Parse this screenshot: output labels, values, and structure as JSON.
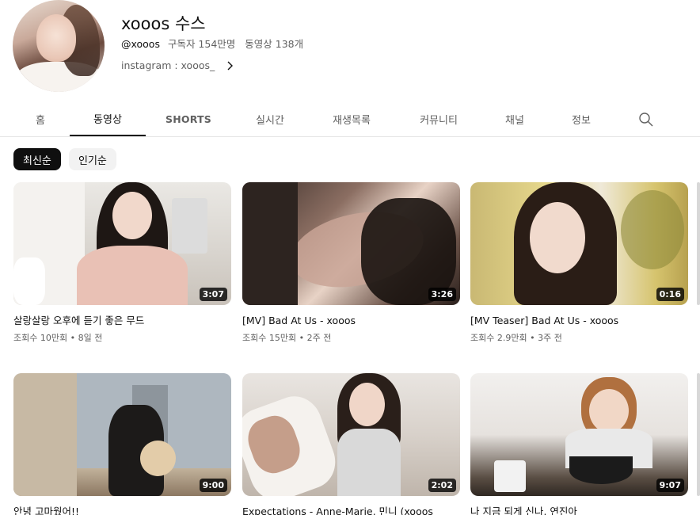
{
  "channel": {
    "name": "xooos 수스",
    "handle": "@xooos",
    "subscribers": "구독자 154만명",
    "video_count": "동영상 138개",
    "link": "instagram : xooos_"
  },
  "tabs": [
    {
      "label": "홈",
      "active": false
    },
    {
      "label": "동영상",
      "active": true
    },
    {
      "label": "SHORTS",
      "active": false
    },
    {
      "label": "실시간",
      "active": false
    },
    {
      "label": "재생목록",
      "active": false
    },
    {
      "label": "커뮤니티",
      "active": false
    },
    {
      "label": "채널",
      "active": false
    },
    {
      "label": "정보",
      "active": false
    }
  ],
  "chips": [
    {
      "label": "최신순",
      "selected": true
    },
    {
      "label": "인기순",
      "selected": false
    }
  ],
  "videos": [
    {
      "title": "살랑살랑 오후에 듣기 좋은 무드",
      "views": "조회수 10만회",
      "age": "8일 전",
      "duration": "3:07"
    },
    {
      "title": "[MV] Bad At Us - xooos",
      "views": "조회수 15만회",
      "age": "2주 전",
      "duration": "3:26"
    },
    {
      "title": "[MV Teaser] Bad At Us - xooos",
      "views": "조회수 2.9만회",
      "age": "3주 전",
      "duration": "0:16"
    },
    {
      "title": "안녕 고마웠어!!",
      "views": "",
      "age": "",
      "duration": "9:00"
    },
    {
      "title": "Expectations - Anne-Marie, 민니 (xooos",
      "views": "",
      "age": "",
      "duration": "2:02"
    },
    {
      "title": "나 지금 되게 신나, 연진아",
      "views": "",
      "age": "",
      "duration": "9:07"
    }
  ],
  "icons": {
    "link_chevron": "chevron-right-icon",
    "search": "search-icon"
  }
}
